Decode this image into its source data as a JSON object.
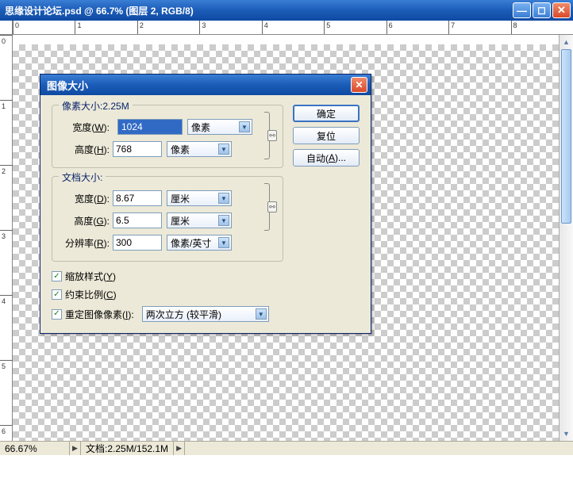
{
  "window": {
    "title": "思缘设计论坛.psd @ 66.7% (图层 2, RGB/8)"
  },
  "ruler_h": [
    "0",
    "1",
    "2",
    "3",
    "4",
    "5",
    "6",
    "7",
    "8"
  ],
  "ruler_v": [
    "0",
    "1",
    "2",
    "3",
    "4",
    "5",
    "6"
  ],
  "statusbar": {
    "zoom": "66.67%",
    "doc": "文档:2.25M/152.1M"
  },
  "dialog": {
    "title": "图像大小",
    "pixel_dims": {
      "legend": "像素大小:2.25M",
      "width_label": "宽度(W):",
      "width_value": "1024",
      "width_unit": "像素",
      "height_label": "高度(H):",
      "height_value": "768",
      "height_unit": "像素"
    },
    "doc_size": {
      "legend": "文档大小:",
      "width_label": "宽度(D):",
      "width_value": "8.67",
      "width_unit": "厘米",
      "height_label": "高度(G):",
      "height_value": "6.5",
      "height_unit": "厘米",
      "res_label": "分辨率(R):",
      "res_value": "300",
      "res_unit": "像素/英寸"
    },
    "scale_styles": "缩放样式(Y)",
    "constrain": "约束比例(C)",
    "resample": "重定图像像素(I):",
    "resample_method": "两次立方 (较平滑)",
    "buttons": {
      "ok": "确定",
      "reset": "复位",
      "auto": "自动(A)..."
    }
  }
}
